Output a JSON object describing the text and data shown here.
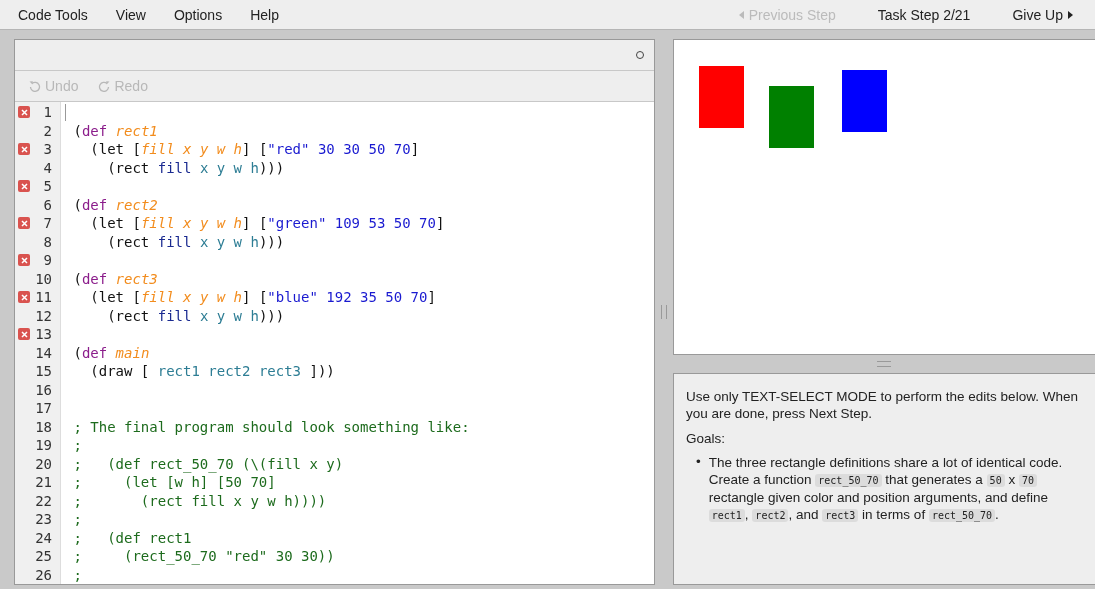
{
  "menu": [
    {
      "label": "Code Tools"
    },
    {
      "label": "View"
    },
    {
      "label": "Options"
    },
    {
      "label": "Help"
    }
  ],
  "nav": {
    "previous": {
      "label": "Previous Step",
      "disabled": true
    },
    "step": "Task Step 2/21",
    "give_up": {
      "label": "Give Up",
      "disabled": false
    }
  },
  "toolbar": [
    {
      "kind": "undo",
      "label": "Undo",
      "disabled": true
    },
    {
      "kind": "redo",
      "label": "Redo",
      "disabled": true
    }
  ],
  "code_lines": [
    {
      "number": "1",
      "error": true
    },
    {
      "number": "2",
      "error": false,
      "tokens": [
        {
          "t": "(",
          "kind": "plain"
        },
        {
          "t": "def",
          "kind": "kw"
        },
        {
          "t": " rect1",
          "kind": "name"
        }
      ]
    },
    {
      "number": "3",
      "error": true,
      "tokens": [
        {
          "t": "  (let [",
          "kind": "plain"
        },
        {
          "t": "fill x y w h",
          "kind": "var"
        },
        {
          "t": "] [",
          "kind": "plain"
        },
        {
          "t": "\"red\" 30 30 50 70",
          "kind": "lit"
        },
        {
          "t": "]",
          "kind": "plain"
        }
      ]
    },
    {
      "number": "4",
      "error": false,
      "tokens": [
        {
          "t": "    (rect ",
          "kind": "plain"
        },
        {
          "t": "fill",
          "kind": "fn"
        },
        {
          "t": " x y w h",
          "kind": "ident"
        },
        {
          "t": ")))",
          "kind": "plain"
        }
      ]
    },
    {
      "number": "5",
      "error": true
    },
    {
      "number": "6",
      "error": false,
      "tokens": [
        {
          "t": "(",
          "kind": "plain"
        },
        {
          "t": "def",
          "kind": "kw"
        },
        {
          "t": " rect2",
          "kind": "name"
        }
      ]
    },
    {
      "number": "7",
      "error": true,
      "tokens": [
        {
          "t": "  (let [",
          "kind": "plain"
        },
        {
          "t": "fill x y w h",
          "kind": "var"
        },
        {
          "t": "] [",
          "kind": "plain"
        },
        {
          "t": "\"green\" 109 53 50 70",
          "kind": "lit"
        },
        {
          "t": "]",
          "kind": "plain"
        }
      ]
    },
    {
      "number": "8",
      "error": false,
      "tokens": [
        {
          "t": "    (rect ",
          "kind": "plain"
        },
        {
          "t": "fill",
          "kind": "fn"
        },
        {
          "t": " x y w h",
          "kind": "ident"
        },
        {
          "t": ")))",
          "kind": "plain"
        }
      ]
    },
    {
      "number": "9",
      "error": true
    },
    {
      "number": "10",
      "error": false,
      "tokens": [
        {
          "t": "(",
          "kind": "plain"
        },
        {
          "t": "def",
          "kind": "kw"
        },
        {
          "t": " rect3",
          "kind": "name"
        }
      ]
    },
    {
      "number": "11",
      "error": true,
      "tokens": [
        {
          "t": "  (let [",
          "kind": "plain"
        },
        {
          "t": "fill x y w h",
          "kind": "var"
        },
        {
          "t": "] [",
          "kind": "plain"
        },
        {
          "t": "\"blue\" 192 35 50 70",
          "kind": "lit"
        },
        {
          "t": "]",
          "kind": "plain"
        }
      ]
    },
    {
      "number": "12",
      "error": false,
      "tokens": [
        {
          "t": "    (rect ",
          "kind": "plain"
        },
        {
          "t": "fill",
          "kind": "fn"
        },
        {
          "t": " x y w h",
          "kind": "ident"
        },
        {
          "t": ")))",
          "kind": "plain"
        }
      ]
    },
    {
      "number": "13",
      "error": true
    },
    {
      "number": "14",
      "error": false,
      "tokens": [
        {
          "t": "(",
          "kind": "plain"
        },
        {
          "t": "def",
          "kind": "kw"
        },
        {
          "t": " main",
          "kind": "name"
        }
      ]
    },
    {
      "number": "15",
      "error": false,
      "tokens": [
        {
          "t": "  (draw [ ",
          "kind": "plain"
        },
        {
          "t": "rect1 rect2 rect3",
          "kind": "ident"
        },
        {
          "t": " ]))",
          "kind": "plain"
        }
      ]
    },
    {
      "number": "16",
      "error": false
    },
    {
      "number": "17",
      "error": false
    },
    {
      "number": "18",
      "error": false,
      "tokens": [
        {
          "t": "; The final program should look something like:",
          "kind": "comment"
        }
      ]
    },
    {
      "number": "19",
      "error": false,
      "tokens": [
        {
          "t": ";",
          "kind": "comment"
        }
      ]
    },
    {
      "number": "20",
      "error": false,
      "tokens": [
        {
          "t": ";   (def rect_50_70 (\\(fill x y)",
          "kind": "comment"
        }
      ]
    },
    {
      "number": "21",
      "error": false,
      "tokens": [
        {
          "t": ";     (let [w h] [50 70]",
          "kind": "comment"
        }
      ]
    },
    {
      "number": "22",
      "error": false,
      "tokens": [
        {
          "t": ";       (rect fill x y w h))))",
          "kind": "comment"
        }
      ]
    },
    {
      "number": "23",
      "error": false,
      "tokens": [
        {
          "t": ";",
          "kind": "comment"
        }
      ]
    },
    {
      "number": "24",
      "error": false,
      "tokens": [
        {
          "t": ";   (def rect1",
          "kind": "comment"
        }
      ]
    },
    {
      "number": "25",
      "error": false,
      "tokens": [
        {
          "t": ";     (rect_50_70 \"red\" 30 30))",
          "kind": "comment"
        }
      ]
    },
    {
      "number": "26",
      "error": false,
      "tokens": [
        {
          "t": ";",
          "kind": "comment"
        }
      ]
    }
  ],
  "canvas": {
    "shapes": [
      {
        "color": "#ff0000"
      },
      {
        "color": "#008000"
      },
      {
        "color": "#0000ff"
      }
    ]
  },
  "instructions": {
    "intro": "Use only TEXT-SELECT MODE to perform the edits below. When you are done, press Next Step.",
    "goals_label": "Goals:",
    "goals": [
      {
        "bullet": "•",
        "parts": [
          {
            "kind": "text",
            "t": "The three rectangle definitions share a lot of identical code. Create a function "
          },
          {
            "kind": "code",
            "t": "rect_50_70"
          },
          {
            "kind": "text",
            "t": " that generates a "
          },
          {
            "kind": "code",
            "t": "50"
          },
          {
            "kind": "text",
            "t": " x "
          },
          {
            "kind": "code",
            "t": "70"
          },
          {
            "kind": "text",
            "t": " rectangle given color and position arguments, and define "
          },
          {
            "kind": "code",
            "t": "rect1"
          },
          {
            "kind": "text",
            "t": ", "
          },
          {
            "kind": "code",
            "t": "rect2"
          },
          {
            "kind": "text",
            "t": ", and "
          },
          {
            "kind": "code",
            "t": "rect3"
          },
          {
            "kind": "text",
            "t": " in terms of "
          },
          {
            "kind": "code",
            "t": "rect_50_70"
          },
          {
            "kind": "text",
            "t": "."
          }
        ]
      }
    ]
  }
}
